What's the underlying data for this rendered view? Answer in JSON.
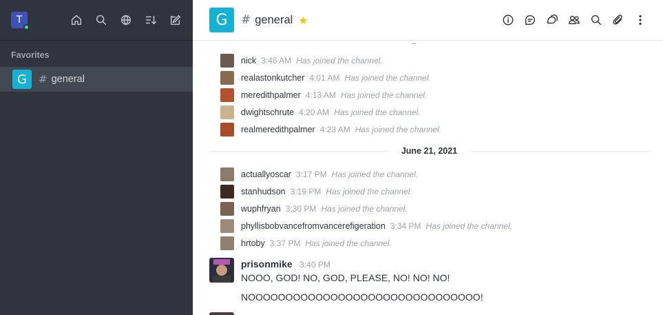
{
  "sidebar": {
    "user_initial": "T",
    "section_title": "Favorites",
    "rooms": [
      {
        "initial": "G",
        "hash": "#",
        "name": "general"
      }
    ],
    "icons": [
      "home-icon",
      "search-icon",
      "directory-icon",
      "sort-icon",
      "create-new-icon"
    ]
  },
  "header": {
    "initial": "G",
    "hash": "#",
    "title": "general",
    "star": "★",
    "tools": [
      "info-icon",
      "discussion-icon",
      "threads-icon",
      "members-icon",
      "search-icon",
      "files-icon",
      "kebab-icon"
    ]
  },
  "messages": {
    "system_before": [
      {
        "user": "nick",
        "time": "3:46 AM",
        "text": "Has joined the channel.",
        "avatar_color": "#6b5a4e"
      },
      {
        "user": "realastonkutcher",
        "time": "4:01 AM",
        "text": "Has joined the channel.",
        "avatar_color": "#8a6a4e"
      },
      {
        "user": "meredithpalmer",
        "time": "4:13 AM",
        "text": "Has joined the channel.",
        "avatar_color": "#b3522e"
      },
      {
        "user": "dwightschrute",
        "time": "4:20 AM",
        "text": "Has joined the channel.",
        "avatar_color": "#c8b38e"
      },
      {
        "user": "realmeredithpalmer",
        "time": "4:23 AM",
        "text": "Has joined the channel.",
        "avatar_color": "#a84d2a"
      }
    ],
    "date_divider": "June 21, 2021",
    "system_after": [
      {
        "user": "actuallyoscar",
        "time": "3:17 PM",
        "text": "Has joined the channel.",
        "avatar_color": "#8c7a6a"
      },
      {
        "user": "stanhudson",
        "time": "3:19 PM",
        "text": "Has joined the channel.",
        "avatar_color": "#3a2a22"
      },
      {
        "user": "wuphfryan",
        "time": "3:30 PM",
        "text": "Has joined the channel.",
        "avatar_color": "#7a6250"
      },
      {
        "user": "phyllisbobvancefromvancerefigeration",
        "time": "3:34 PM",
        "text": "Has joined the channel.",
        "avatar_color": "#9e8a7a"
      },
      {
        "user": "hrtoby",
        "time": "3:37 PM",
        "text": "Has joined the channel.",
        "avatar_color": "#8f8070"
      }
    ],
    "main_message": {
      "user": "prisonmike",
      "time": "3:40 PM",
      "lines": [
        "NOOO, GOD! NO, GOD, PLEASE, NO! NO! NO!",
        "NOOOOOOOOOOOOOOOOOOOOOOOOOOOOOOO!"
      ]
    }
  }
}
